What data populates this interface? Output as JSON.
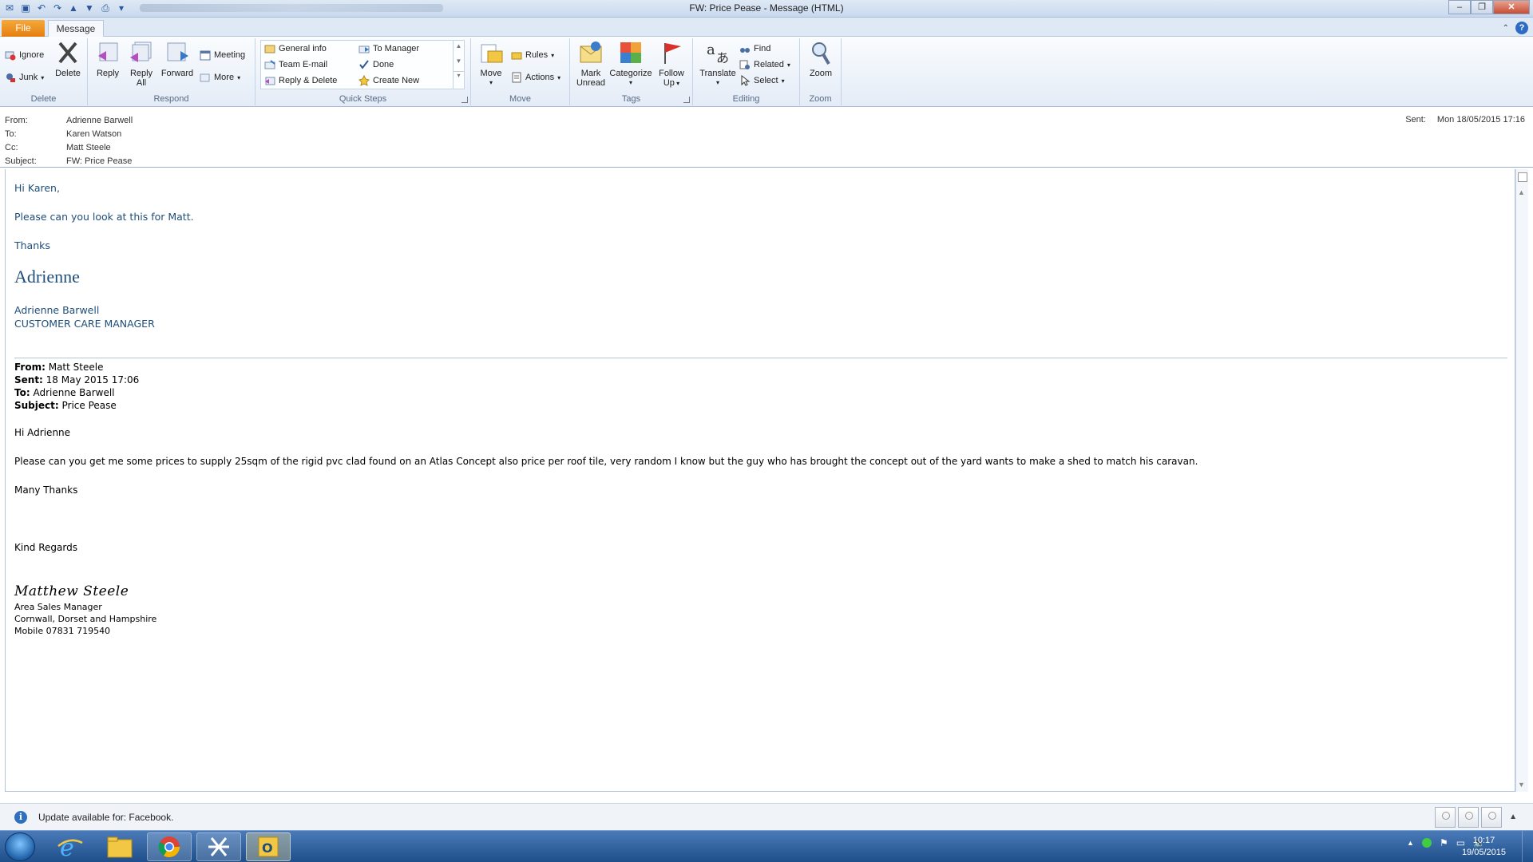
{
  "window": {
    "title": "FW: Price Pease  -  Message (HTML)"
  },
  "tabs": {
    "file": "File",
    "message": "Message"
  },
  "ribbon": {
    "delete_group": {
      "label": "Delete",
      "ignore": "Ignore",
      "junk": "Junk",
      "delete": "Delete"
    },
    "respond_group": {
      "label": "Respond",
      "reply": "Reply",
      "reply_all_1": "Reply",
      "reply_all_2": "All",
      "forward": "Forward",
      "meeting": "Meeting",
      "more": "More"
    },
    "quicksteps_group": {
      "label": "Quick Steps",
      "items": [
        "General info",
        "Team E-mail",
        "Reply & Delete",
        "To Manager",
        "Done",
        "Create New"
      ]
    },
    "move_group": {
      "label": "Move",
      "move": "Move",
      "rules": "Rules",
      "actions": "Actions"
    },
    "tags_group": {
      "label": "Tags",
      "mark_unread_1": "Mark",
      "mark_unread_2": "Unread",
      "categorize": "Categorize",
      "follow_up_1": "Follow",
      "follow_up_2": "Up"
    },
    "editing_group": {
      "label": "Editing",
      "translate": "Translate",
      "find": "Find",
      "related": "Related",
      "select": "Select"
    },
    "zoom_group": {
      "label": "Zoom",
      "zoom": "Zoom"
    }
  },
  "header": {
    "from_label": "From:",
    "from": "Adrienne Barwell",
    "to_label": "To:",
    "to": "Karen Watson",
    "cc_label": "Cc:",
    "cc": "Matt Steele",
    "subject_label": "Subject:",
    "subject": "FW: Price Pease",
    "sent_label": "Sent:",
    "sent": "Mon 18/05/2015 17:16"
  },
  "body": {
    "greeting": "Hi Karen,",
    "line1": "Please can you look at this for Matt.",
    "thanks": "Thanks",
    "sig_first": "Adrienne",
    "sig_name": "Adrienne Barwell",
    "sig_title": "CUSTOMER CARE MANAGER",
    "fwd_from_label": "From:",
    "fwd_from": " Matt Steele",
    "fwd_sent_label": "Sent:",
    "fwd_sent": " 18 May 2015 17:06",
    "fwd_to_label": "To:",
    "fwd_to": " Adrienne Barwell",
    "fwd_subject_label": "Subject:",
    "fwd_subject": " Price Pease",
    "fwd_greeting": "Hi Adrienne",
    "fwd_text": "Please can you get me some prices to supply 25sqm of the rigid pvc clad found on an Atlas Concept also price per roof tile, very random I know but the guy who has brought the concept out of the yard wants to make a shed to match his caravan.",
    "many_thanks": "Many Thanks",
    "kind_regards": "Kind Regards",
    "signature_script": "Matthew Steele",
    "sig2_title": "Area Sales Manager",
    "sig2_region": "Cornwall, Dorset and Hampshire",
    "sig2_mobile": "Mobile 07831 719540"
  },
  "infobar": {
    "text": "Update available for: Facebook."
  },
  "taskbar": {
    "time": "10:17",
    "date": "19/05/2015"
  },
  "colors": {
    "accent": "#2b579a",
    "file_tab": "#e57e10",
    "body_text": "#1f4e79"
  }
}
